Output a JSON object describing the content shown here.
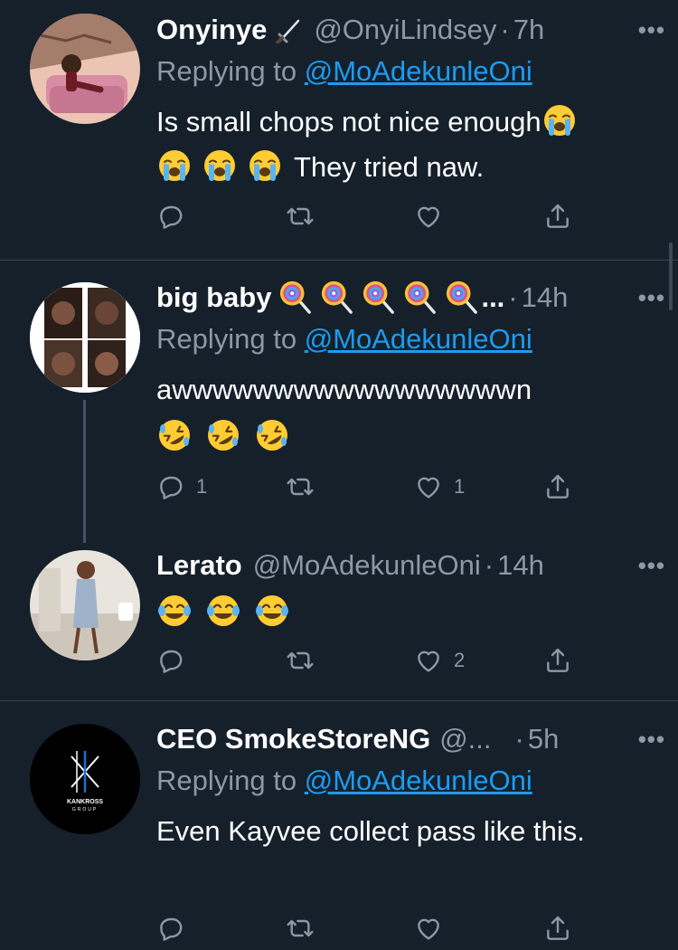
{
  "tweets": [
    {
      "name": "Onyinye",
      "name_icon": "dagger-icon",
      "handle": "@OnyiLindsey",
      "time": "7h",
      "reply_prefix": "Replying to",
      "reply_to": "@MoAdekunleOni",
      "text": "Is small chops not nice enough",
      "text2": "They tried naw.",
      "emoji": "loudly-crying-face",
      "counts": {
        "reply": "",
        "retweet": "",
        "like": ""
      }
    },
    {
      "name": "big baby",
      "name_suffix": "...",
      "name_icon": "lollipop-icon",
      "handle": "",
      "time": "14h",
      "reply_prefix": "Replying to",
      "reply_to": "@MoAdekunleOni",
      "text": "awwwwwwwwwwwwwwwwwn",
      "emoji": "rolling-on-floor-laughing",
      "counts": {
        "reply": "1",
        "retweet": "",
        "like": "1"
      }
    },
    {
      "name": "Lerato",
      "handle": "@MoAdekunleOni",
      "time": "14h",
      "emoji": "face-with-tears-of-joy",
      "counts": {
        "reply": "",
        "retweet": "",
        "like": "2"
      }
    },
    {
      "name": "CEO SmokeStoreNG",
      "handle": "@...",
      "time": "5h",
      "reply_prefix": "Replying to",
      "reply_to": "@MoAdekunleOni",
      "text": "Even Kayvee collect pass like this.",
      "avatar_logo_text": "KANKROSS",
      "avatar_logo_sub": "GROUP",
      "counts": {
        "reply": "",
        "retweet": "",
        "like": ""
      }
    }
  ],
  "separator": "·",
  "more_label": "•••",
  "colors": {
    "background": "#15202b",
    "secondary_text": "#8b98a5",
    "link": "#1d9bf0",
    "divider": "#38444d"
  }
}
